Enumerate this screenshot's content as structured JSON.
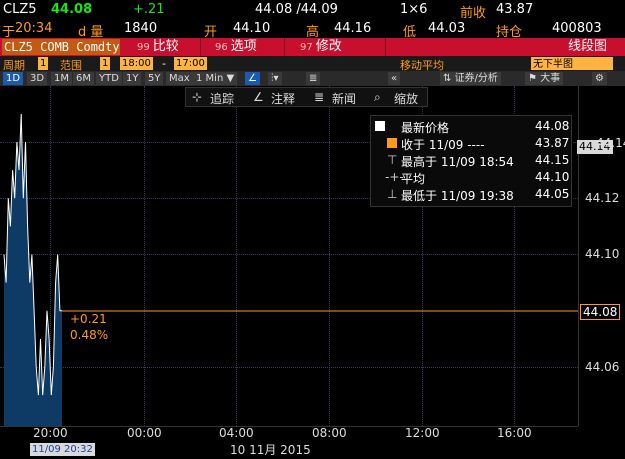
{
  "header": {
    "ticker": "CLZ5",
    "last": "44.08",
    "change": "+.21",
    "bid_ask": "44.08 /44.09",
    "size": "1×6",
    "prev_close_label": "前收",
    "prev_close": "43.87",
    "time_label": "于",
    "time": "20:34",
    "volume_label": "d 量",
    "volume": "1840",
    "open_label": "开",
    "open": "44.10",
    "high_label": "高",
    "high": "44.16",
    "low_label": "低",
    "low": "44.03",
    "oi_label": "持仓",
    "oi": "400803"
  },
  "function_bar": {
    "security": "CLZ5 COMB Comdty",
    "items": [
      {
        "num": "99",
        "label": "比较"
      },
      {
        "num": "96",
        "label": "选项"
      },
      {
        "num": "97",
        "label": "修改"
      }
    ],
    "right_label": "线段图"
  },
  "period_row": {
    "period_label": "周期",
    "period_value": "1",
    "range_label": "范围",
    "range_value": "1",
    "start_time": "18:00",
    "dash": "-",
    "end_time": "17:00",
    "ma_label": "移动平均",
    "ma_value": "无下半图"
  },
  "toolbar": {
    "ranges": [
      "1D",
      "3D",
      "1M",
      "6M",
      "YTD",
      "1Y",
      "5Y",
      "Max"
    ],
    "active_range": "1D",
    "interval": "1 Min ▼",
    "right_items": [
      "证券/分析",
      "大事"
    ]
  },
  "annotation_bar": {
    "items": [
      "追踪",
      "注释",
      "新闻",
      "缩放"
    ]
  },
  "legend": {
    "rows": [
      {
        "label": "最新价格",
        "value": "44.08"
      },
      {
        "label": "收于 11/09 ----",
        "value": "43.87"
      },
      {
        "label": "最高于 11/09 18:54",
        "value": "44.15"
      },
      {
        "label": "平均",
        "value": "44.10"
      },
      {
        "label": "最低于 11/09 19:38",
        "value": "44.05"
      }
    ]
  },
  "change_annotation": {
    "abs": "+0.21",
    "pct": "0.48%"
  },
  "axis": {
    "y_ticks": [
      "44.14",
      "44.12",
      "44.10",
      "44.06"
    ],
    "last_tag": "44.08",
    "high_tag": "44.14",
    "x_ticks": [
      "20:00",
      "00:00",
      "04:00",
      "08:00",
      "12:00",
      "16:00"
    ],
    "date_label": "10 11月 2015",
    "cursor_time": "11/09 20:32"
  },
  "colors": {
    "accent": "#ff9a1f",
    "bar_red": "#c8102e",
    "price_line": "#ffffff",
    "area_fill": "#0e3a66"
  },
  "chart_data": {
    "type": "area",
    "series": [
      {
        "name": "最新价格",
        "values": [
          44.1,
          44.09,
          44.12,
          44.11,
          44.13,
          44.12,
          44.14,
          44.13,
          44.15,
          44.12,
          44.14,
          44.11,
          44.09,
          44.1,
          44.08,
          44.06,
          44.05,
          44.07,
          44.05,
          44.06,
          44.08,
          44.07,
          44.05,
          44.06,
          44.09,
          44.1,
          44.08,
          44.08
        ]
      }
    ],
    "ylim": [
      44.03,
      44.16
    ]
  }
}
